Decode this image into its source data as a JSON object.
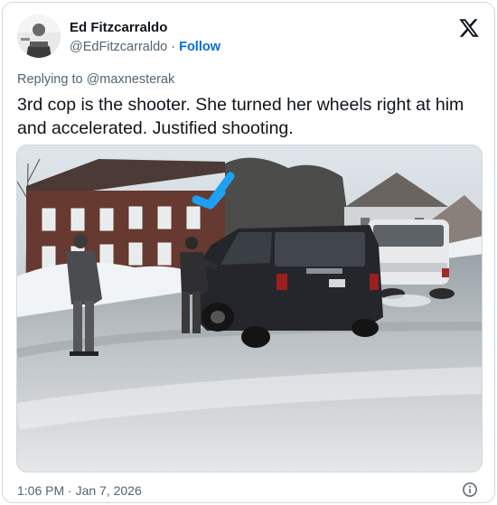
{
  "author": {
    "name": "Ed Fitzcarraldo",
    "handle": "@EdFitzcarraldo",
    "separator": " · ",
    "follow_label": "Follow"
  },
  "reply_context": {
    "prefix": "Replying to ",
    "target": "@maxnesterak"
  },
  "tweet": {
    "text": "3rd cop is the shooter. She turned her wheels right at him and accelerated. Justified shooting."
  },
  "footer": {
    "timestamp": "1:06 PM · Jan 7, 2026"
  },
  "icons": {
    "brand": "x-logo-icon",
    "info": "info-icon",
    "annotation": "arrow-annotation-icon"
  },
  "colors": {
    "text_primary": "#0f1419",
    "text_secondary": "#536471",
    "link": "#1d9bf0",
    "follow": "#006fd6",
    "arrow_annotation": "#1da1f2"
  }
}
